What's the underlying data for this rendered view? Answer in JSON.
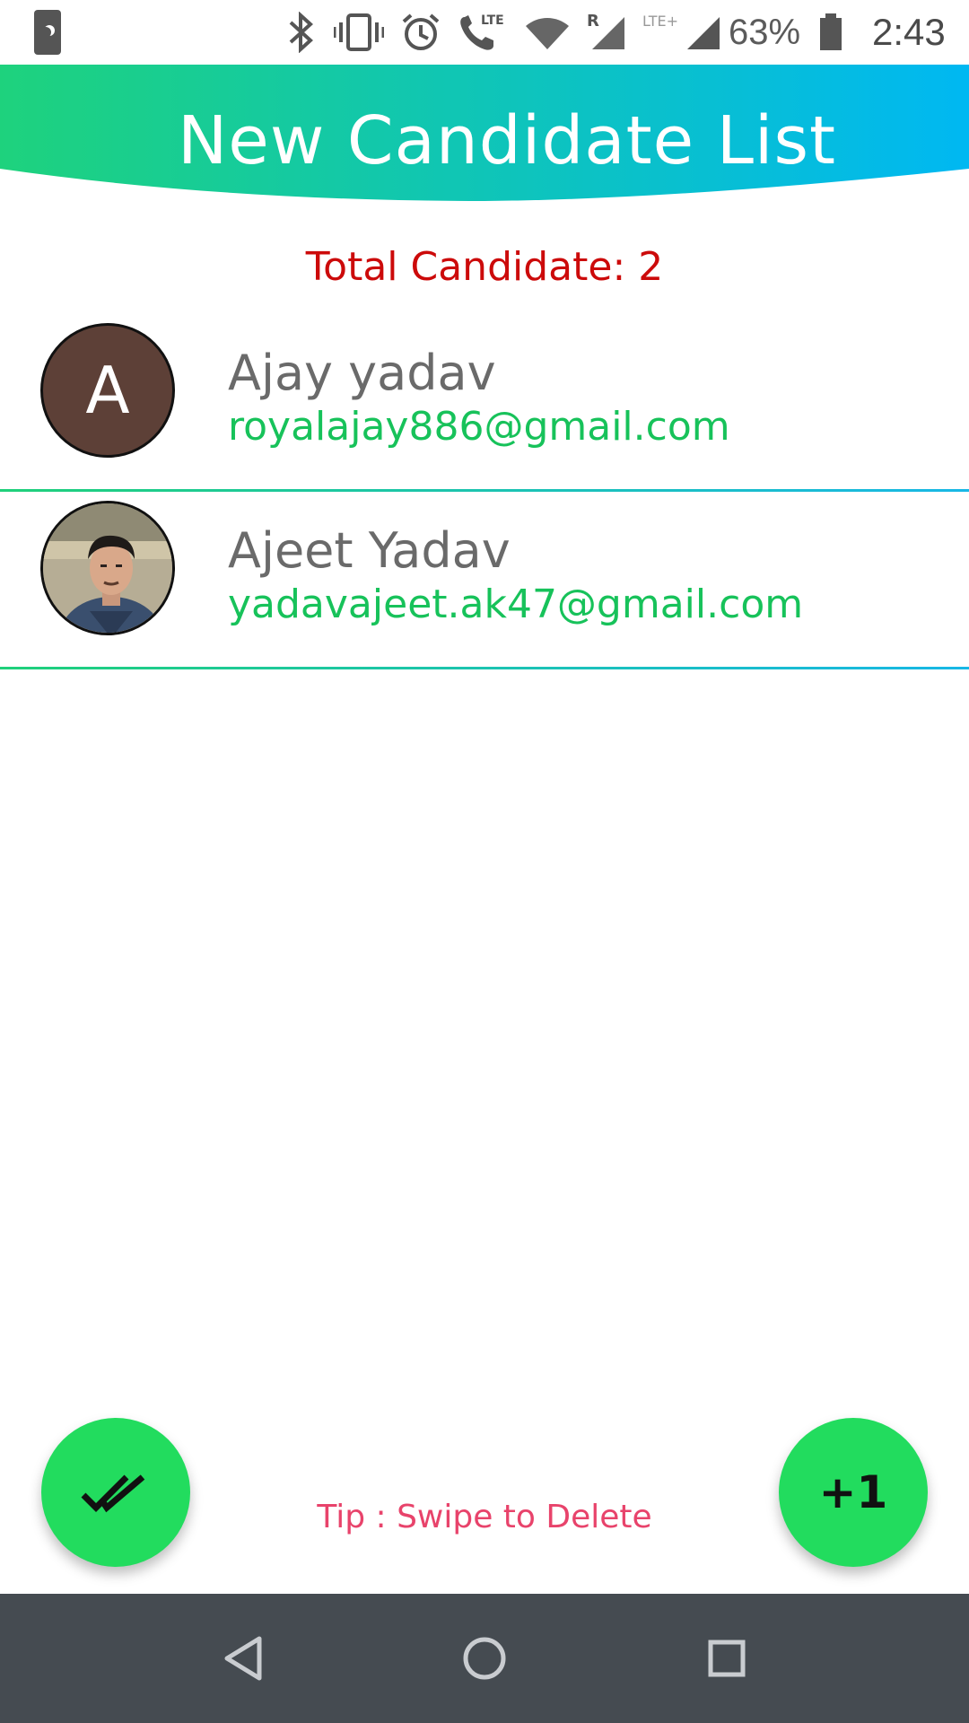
{
  "status_bar": {
    "battery_percent": "63%",
    "time": "2:43",
    "icons": [
      "moon-icon",
      "bluetooth-icon",
      "vibrate-icon",
      "alarm-icon",
      "volte-call-icon",
      "wifi-icon",
      "signal-roaming-icon",
      "signal-lte-plus-icon",
      "battery-icon"
    ]
  },
  "header": {
    "title": "New Candidate List",
    "gradient": [
      "#1ed27d",
      "#00b8f2"
    ]
  },
  "summary": {
    "total_label": "Total Candidate: 2"
  },
  "candidates": [
    {
      "name": "Ajay yadav",
      "email": "royalajay886@gmail.com",
      "avatar_letter": "A",
      "avatar_color": "#5d4037"
    },
    {
      "name": "Ajeet Yadav",
      "email": "yadavajeet.ak47@gmail.com",
      "avatar_type": "photo"
    }
  ],
  "actions": {
    "left_fab_icon": "double-check-icon",
    "right_fab_label": "+1",
    "fab_color": "#22dc5e"
  },
  "tip": "Tip : Swipe to Delete",
  "navbar": {
    "buttons": [
      "back-icon",
      "home-icon",
      "recents-icon"
    ]
  }
}
